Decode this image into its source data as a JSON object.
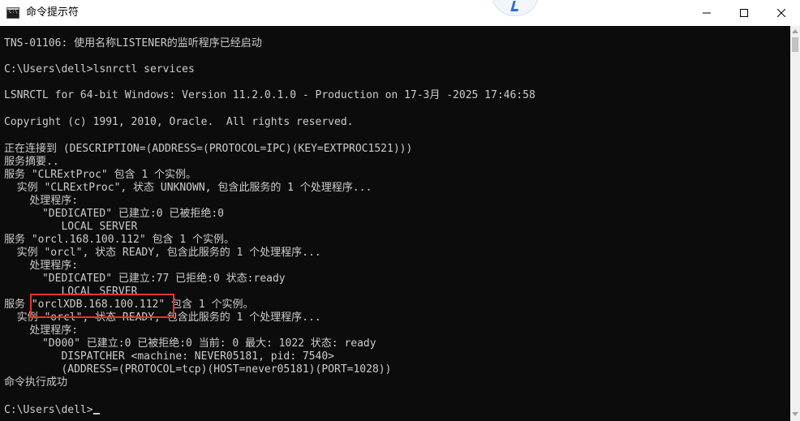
{
  "window": {
    "title": "命令提示符",
    "icon_label": "C:\\",
    "controls": {
      "minimize": "minimize-icon",
      "maximize": "maximize-icon",
      "close": "close-icon"
    }
  },
  "console": {
    "lines": [
      "TNS-01106: 使用名称LISTENER的监听程序已经启动",
      "",
      "C:\\Users\\dell>lsnrctl services",
      "",
      "LSNRCTL for 64-bit Windows: Version 11.2.0.1.0 - Production on 17-3月 -2025 17:46:58",
      "",
      "Copyright (c) 1991, 2010, Oracle.  All rights reserved.",
      "",
      "正在连接到 (DESCRIPTION=(ADDRESS=(PROTOCOL=IPC)(KEY=EXTPROC1521)))",
      "服务摘要..",
      "服务 \"CLRExtProc\" 包含 1 个实例。",
      "  实例 \"CLRExtProc\", 状态 UNKNOWN, 包含此服务的 1 个处理程序...",
      "    处理程序:",
      "      \"DEDICATED\" 已建立:0 已被拒绝:0",
      "         LOCAL SERVER",
      "服务 \"orcl.168.100.112\" 包含 1 个实例。",
      "  实例 \"orcl\", 状态 READY, 包含此服务的 1 个处理程序...",
      "    处理程序:",
      "      \"DEDICATED\" 已建立:77 已拒绝:0 状态:ready",
      "         LOCAL SERVER",
      "服务 \"orclXDB.168.100.112\" 包含 1 个实例。",
      "  实例 \"orcl\", 状态 READY, 包含此服务的 1 个处理程序...",
      "    处理程序:",
      "      \"D000\" 已建立:0 已被拒绝:0 当前: 0 最大: 1022 状态: ready",
      "         DISPATCHER <machine: NEVER05181, pid: 7540>",
      "         (ADDRESS=(PROTOCOL=tcp)(HOST=never05181)(PORT=1028))",
      "命令执行成功",
      "",
      "C:\\Users\\dell>"
    ]
  },
  "colors": {
    "console_bg": "#0c0c0c",
    "console_text": "#cccccc",
    "highlight_box": "#e8332a",
    "titlebar_bg": "#ffffff"
  }
}
